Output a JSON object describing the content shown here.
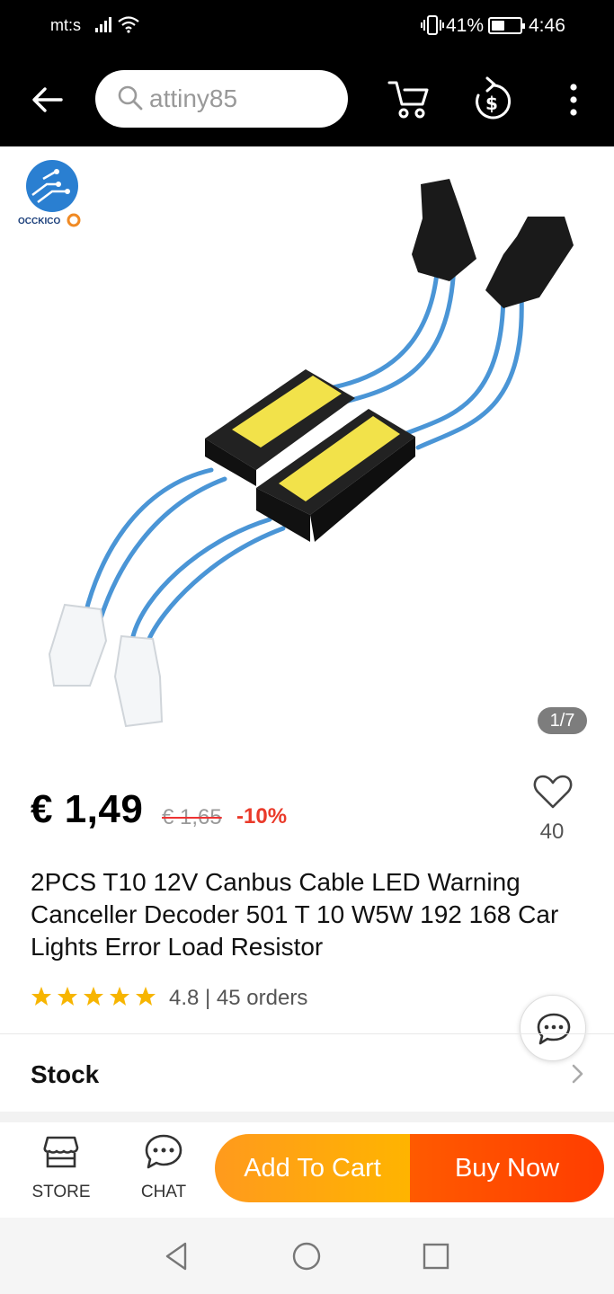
{
  "status_bar": {
    "carrier": "mt:s",
    "battery_percent": "41%",
    "battery_level": 0.41,
    "time": "4:46"
  },
  "top_nav": {
    "search_query": "attiny85",
    "icons": [
      "back-arrow-icon",
      "search-icon",
      "cart-icon",
      "coin-dollar-icon",
      "more-vertical-icon"
    ]
  },
  "gallery": {
    "store_logo_text": "OCCKICO",
    "image_counter": "1/7"
  },
  "product": {
    "price": "€ 1,49",
    "original_price": "€ 1,65",
    "discount": "-10%",
    "wishlist_count": "40",
    "title": "2PCS T10 12V Canbus Cable LED Warning Canceller Decoder 501 T 10 W5W 192 168 Car Lights Error Load Resistor",
    "rating_value": 4.8,
    "rating_text": "4.8 | 45 orders",
    "stock_label": "Stock"
  },
  "action_bar": {
    "store_label": "STORE",
    "chat_label": "CHAT",
    "add_to_cart_label": "Add To Cart",
    "buy_now_label": "Buy Now"
  },
  "colors": {
    "accent_orange": "#ffa20e",
    "accent_red": "#ff4a00",
    "discount_red": "#ea3a2a"
  }
}
